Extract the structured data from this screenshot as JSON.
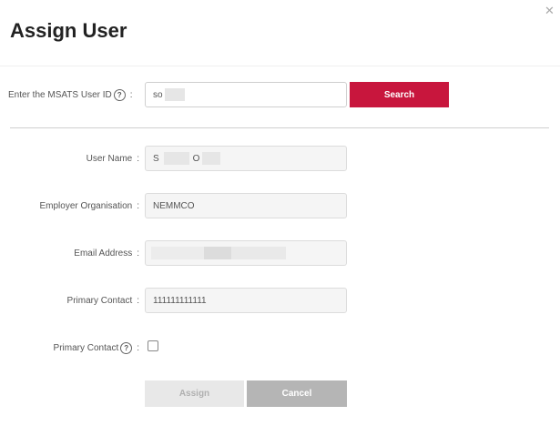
{
  "dialog": {
    "title": "Assign User",
    "close_icon": "close-icon"
  },
  "search": {
    "label": "Enter the MSATS User ID",
    "help_glyph": "?",
    "colon": ":",
    "value": "so",
    "button_label": "Search"
  },
  "fields": {
    "user_name": {
      "label": "User Name",
      "value_prefix": "S",
      "value_middle": "O"
    },
    "employer_organisation": {
      "label": "Employer Organisation",
      "value": "NEMMCO"
    },
    "email_address": {
      "label": "Email Address"
    },
    "primary_contact": {
      "label": "Primary Contact",
      "value": "111111111111"
    },
    "primary_contact_flag": {
      "label": "Primary Contact",
      "help_glyph": "?",
      "checked": false
    }
  },
  "colon": ":",
  "buttons": {
    "assign_label": "Assign",
    "cancel_label": "Cancel"
  }
}
